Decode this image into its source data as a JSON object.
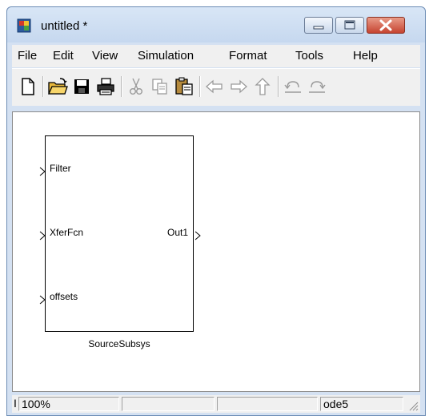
{
  "window": {
    "title": "untitled *",
    "app_icon": "simulink-model-icon",
    "caption_buttons": [
      "minimize-icon",
      "maximize-icon",
      "close-icon"
    ]
  },
  "menu": {
    "items": [
      "File",
      "Edit",
      "View",
      "Simulation",
      "Format",
      "Tools",
      "Help"
    ]
  },
  "toolbar": {
    "buttons": [
      {
        "icon": "new-document-icon",
        "enabled": true
      },
      {
        "icon": "open-folder-icon",
        "enabled": true
      },
      {
        "icon": "save-icon",
        "enabled": true
      },
      {
        "icon": "print-icon",
        "enabled": true
      },
      {
        "icon": "cut-icon",
        "enabled": false
      },
      {
        "icon": "copy-icon",
        "enabled": false
      },
      {
        "icon": "paste-icon",
        "enabled": true
      },
      {
        "icon": "back-arrow-icon",
        "enabled": false
      },
      {
        "icon": "forward-arrow-icon",
        "enabled": false
      },
      {
        "icon": "up-arrow-icon",
        "enabled": false
      },
      {
        "icon": "undo-icon",
        "enabled": false
      },
      {
        "icon": "redo-icon",
        "enabled": false
      }
    ]
  },
  "diagram": {
    "block": {
      "name": "SourceSubsys",
      "inputs": [
        "Filter",
        "XferFcn",
        "offsets"
      ],
      "outputs": [
        "Out1"
      ]
    }
  },
  "statusbar": {
    "left_fragment": "I",
    "zoom": "100%",
    "cell2": "",
    "cell3": "",
    "solver": "ode5"
  },
  "colors": {
    "titlebar": "#c6d8ef",
    "close_button": "#c64431",
    "chrome": "#f0f0f0"
  }
}
